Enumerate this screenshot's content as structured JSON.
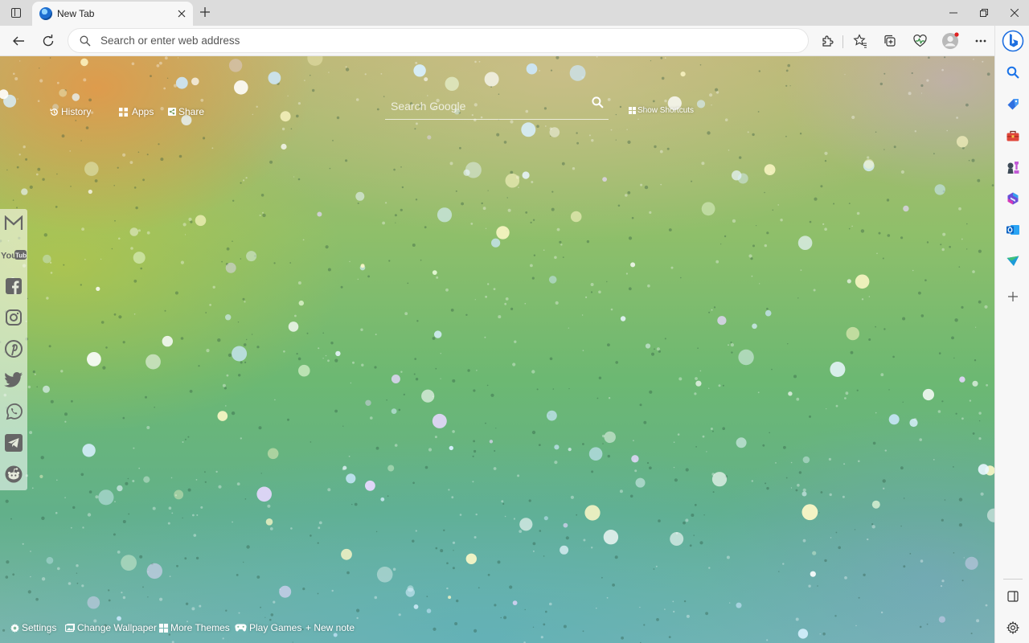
{
  "browser": {
    "tab": {
      "title": "New Tab"
    },
    "address_bar": {
      "placeholder": "Search or enter web address"
    },
    "window_controls": {
      "minimize": "—",
      "restore": "❐",
      "close": "✕"
    }
  },
  "newtab": {
    "top_links": [
      {
        "label": "History",
        "icon": "history-icon"
      },
      {
        "label": "Apps",
        "icon": "apps-grid-icon"
      },
      {
        "label": "Share",
        "icon": "share-icon"
      }
    ],
    "search": {
      "placeholder": "Search Google",
      "icon": "search-icon"
    },
    "show_shortcuts": "Show Shortcuts",
    "social": [
      "gmail-icon",
      "youtube-icon",
      "facebook-icon",
      "instagram-icon",
      "pinterest-icon",
      "twitter-icon",
      "whatsapp-icon",
      "telegram-icon",
      "reddit-icon"
    ],
    "bottom_links": [
      {
        "label": "Settings",
        "icon": "gear-icon"
      },
      {
        "label": "Change Wallpaper",
        "icon": "image-icon"
      },
      {
        "label": "More Themes",
        "icon": "grid-icon"
      },
      {
        "label": "Play Games",
        "icon": "gamepad-icon"
      },
      {
        "label": "+ New note",
        "icon": ""
      }
    ]
  },
  "colors": {
    "edge_sidebar_bg": "#f7f7f7",
    "titlebar_bg": "#dcdcdc",
    "link_text": "#ffffff"
  }
}
